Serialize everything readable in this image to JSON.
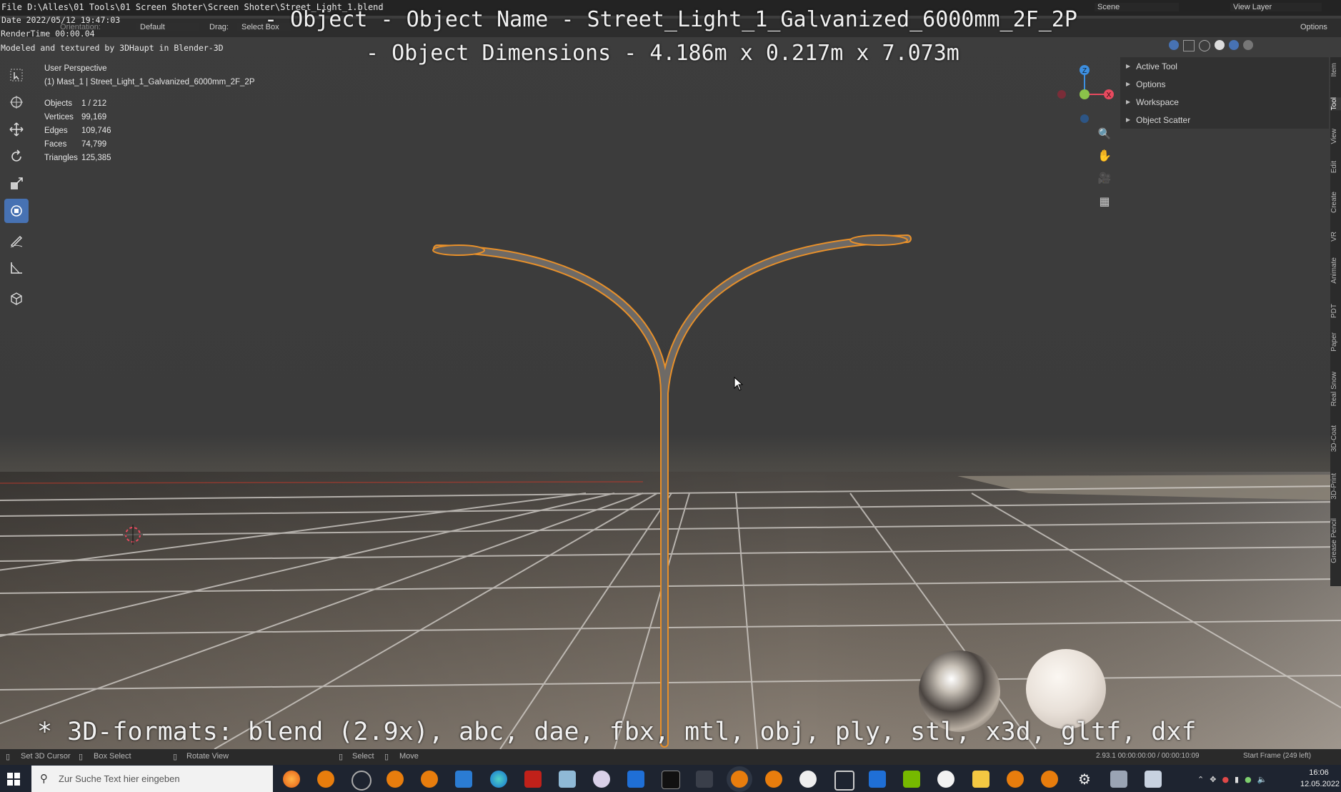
{
  "header": {
    "file_path": "File D:\\Alles\\01 Tools\\01 Screen Shoter\\Screen Shoter\\Street_Light_1.blend",
    "date": "Date 2022/05/12 19:47:03",
    "render_time": "RenderTime 00:00.04",
    "credit": "Modeled and textured by 3DHaupt in Blender-3D",
    "scene_label": "Scene",
    "view_layer_label": "View Layer"
  },
  "toolbar": {
    "orientation_label": "Orientation:",
    "orientation_value": "Default",
    "drag_label": "Drag:",
    "drag_value": "Select Box",
    "options_label": "Options"
  },
  "overlay": {
    "line1": "- Object - Object Name - Street_Light_1_Galvanized_6000mm_2F_2P",
    "line2": "- Object Dimensions -  4.186m x 0.217m x 7.073m",
    "formats": "* 3D-formats: blend (2.9x), abc, dae, fbx, mtl, obj, ply, stl, x3d, gltf, dxf"
  },
  "viewport_info": {
    "perspective": "User Perspective",
    "collection": "(1) Mast_1 | Street_Light_1_Galvanized_6000mm_2F_2P",
    "stats": [
      {
        "label": "Objects",
        "value": "1 / 212"
      },
      {
        "label": "Vertices",
        "value": "99,169"
      },
      {
        "label": "Edges",
        "value": "109,746"
      },
      {
        "label": "Faces",
        "value": "74,799"
      },
      {
        "label": "Triangles",
        "value": "125,385"
      }
    ]
  },
  "gizmo": {
    "z": "Z",
    "x": "X"
  },
  "right_panel": {
    "items": [
      "Active Tool",
      "Options",
      "Workspace",
      "Object Scatter"
    ],
    "tabs": [
      "Item",
      "Tool",
      "View",
      "Edit",
      "Create",
      "VR",
      "Animate",
      "PDT",
      "Paper",
      "Real Snow",
      "3D-Coat",
      "3D-Print",
      "Grease Pencil"
    ]
  },
  "statusbar": {
    "set_cursor": "Set 3D Cursor",
    "box_select": "Box Select",
    "rotate_view": "Rotate View",
    "select": "Select",
    "move": "Move",
    "version_time": "2.93.1  00:00:00:00 / 00:00:10:09",
    "start_frame": "Start Frame (249 left)"
  },
  "taskbar": {
    "search_placeholder": "Zur Suche Text hier eingeben",
    "time": "16:06",
    "date": "12.05.2022"
  },
  "colors": {
    "accent": "#4772b3",
    "selection_outline": "#e8902a",
    "axis_x": "#e84a5f",
    "axis_y": "#8bc34a",
    "axis_z": "#3d8fe0"
  }
}
